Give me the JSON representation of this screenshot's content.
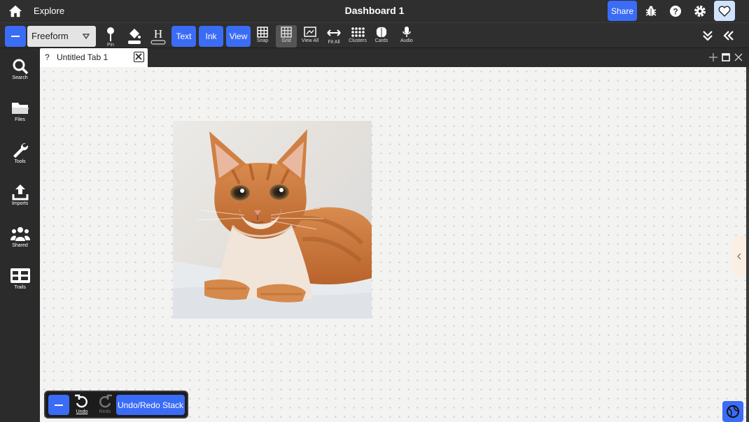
{
  "header": {
    "explore_label": "Explore",
    "title": "Dashboard 1",
    "share_label": "Share",
    "icons": [
      "home-icon",
      "bug-icon",
      "help-icon",
      "gear-icon",
      "heart-icon"
    ]
  },
  "toolbar": {
    "mode_value": "Freeform",
    "pin_label": "Pin",
    "text_label": "Text",
    "ink_label": "Ink",
    "view_label": "View",
    "snap_label": "Snap",
    "grid_label": "Grid",
    "view_all_label": "View All",
    "fit_all_label": "Fit All",
    "clusters_label": "Clusters",
    "cards_label": "Cards",
    "audio_label": "Audio",
    "heading_glyph": "H"
  },
  "sidebar": {
    "items": [
      {
        "label": "Search",
        "icon": "search-icon"
      },
      {
        "label": "Files",
        "icon": "folder-icon"
      },
      {
        "label": "Tools",
        "icon": "wrench-icon"
      },
      {
        "label": "Imports",
        "icon": "upload-icon"
      },
      {
        "label": "Shared",
        "icon": "people-icon"
      },
      {
        "label": "Trails",
        "icon": "trails-icon"
      }
    ]
  },
  "tabs": {
    "active": {
      "title": "Untitled Tab 1",
      "marker": "?"
    }
  },
  "undo_panel": {
    "undo_label": "Undo",
    "redo_label": "Redo",
    "stack_label": "Undo/Redo Stack"
  },
  "colors": {
    "accent": "#3b6cf6",
    "chrome": "#2f2f2f",
    "canvas": "#f3f3f2"
  }
}
